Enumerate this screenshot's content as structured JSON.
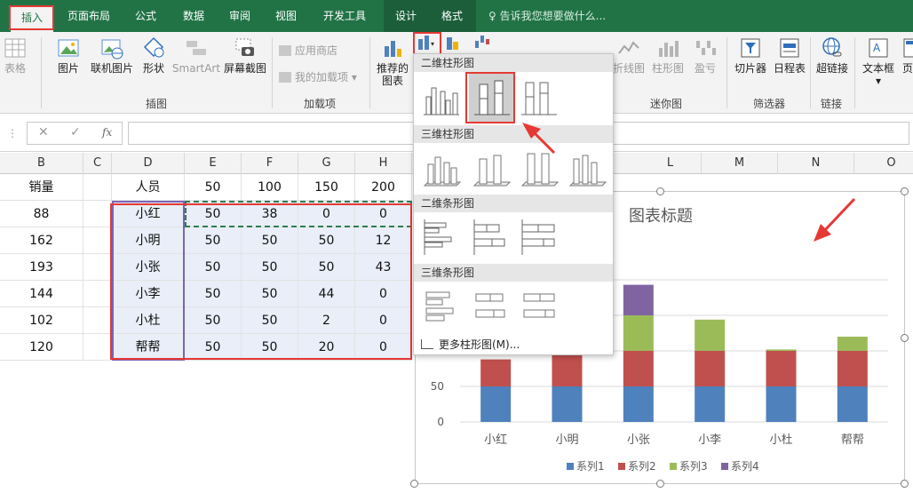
{
  "tabs": [
    {
      "label": "插入",
      "active": true
    },
    {
      "label": "页面布局"
    },
    {
      "label": "公式"
    },
    {
      "label": "数据"
    },
    {
      "label": "审阅"
    },
    {
      "label": "视图"
    },
    {
      "label": "开发工具"
    },
    {
      "label": "设计",
      "contextual": true
    },
    {
      "label": "格式",
      "contextual": true
    }
  ],
  "tell_me": "告诉我您想要做什么...",
  "ribbon": {
    "table": "表格",
    "picture": "图片",
    "online_picture": "联机图片",
    "shapes": "形状",
    "smartart": "SmartArt",
    "screenshot": "屏幕截图",
    "illustrations_group": "插图",
    "store": "应用商店",
    "my_addins": "我的加载项",
    "addins_group": "加载项",
    "recommended_charts": [
      "推荐的",
      "图表"
    ],
    "line_spark": "折线图",
    "column_spark": "柱形图",
    "winloss_spark": "盈亏",
    "sparklines_group": "迷你图",
    "slicer": "切片器",
    "timeline": "日程表",
    "filters_group": "筛选器",
    "hyperlink": "超链接",
    "link_group": "链接",
    "textbox": "文本框",
    "header_footer": "页眉"
  },
  "formula_bar": {
    "cancel": "✕",
    "enter": "✓",
    "fx": "fx"
  },
  "columns": [
    "B",
    "C",
    "D",
    "E",
    "F",
    "G",
    "H",
    "L",
    "M",
    "N",
    "O"
  ],
  "sheet": {
    "header": {
      "b": "销量",
      "d": "人员",
      "vals": [
        "50",
        "100",
        "150",
        "200"
      ]
    },
    "rows": [
      {
        "b": "88",
        "d": "小红",
        "vals": [
          "50",
          "38",
          "0",
          "0"
        ]
      },
      {
        "b": "162",
        "d": "小明",
        "vals": [
          "50",
          "50",
          "50",
          "12"
        ]
      },
      {
        "b": "193",
        "d": "小张",
        "vals": [
          "50",
          "50",
          "50",
          "43"
        ]
      },
      {
        "b": "144",
        "d": "小李",
        "vals": [
          "50",
          "50",
          "44",
          "0"
        ]
      },
      {
        "b": "102",
        "d": "小杜",
        "vals": [
          "50",
          "50",
          "2",
          "0"
        ]
      },
      {
        "b": "120",
        "d": "帮帮",
        "vals": [
          "50",
          "50",
          "20",
          "0"
        ]
      }
    ]
  },
  "dropdown": {
    "sections": [
      "二维柱形图",
      "三维柱形图",
      "二维条形图",
      "三维条形图"
    ],
    "more": "更多柱形图(M)..."
  },
  "chart_data": {
    "type": "bar",
    "stacked": true,
    "title": "图表标题",
    "categories": [
      "小红",
      "小明",
      "小张",
      "小李",
      "小杜",
      "帮帮"
    ],
    "series": [
      {
        "name": "系列1",
        "color": "#4f81bd",
        "values": [
          50,
          50,
          50,
          50,
          50,
          50
        ]
      },
      {
        "name": "系列2",
        "color": "#c0504d",
        "values": [
          38,
          50,
          50,
          50,
          50,
          50
        ]
      },
      {
        "name": "系列3",
        "color": "#9bbb59",
        "values": [
          0,
          50,
          50,
          44,
          2,
          20
        ]
      },
      {
        "name": "系列4",
        "color": "#8064a2",
        "values": [
          0,
          12,
          43,
          0,
          0,
          0
        ]
      }
    ],
    "yticks": [
      "0",
      "50"
    ],
    "grid": true,
    "legend": "bottom"
  },
  "colors": {
    "excel_green": "#217346",
    "highlight_red": "#e53935"
  }
}
